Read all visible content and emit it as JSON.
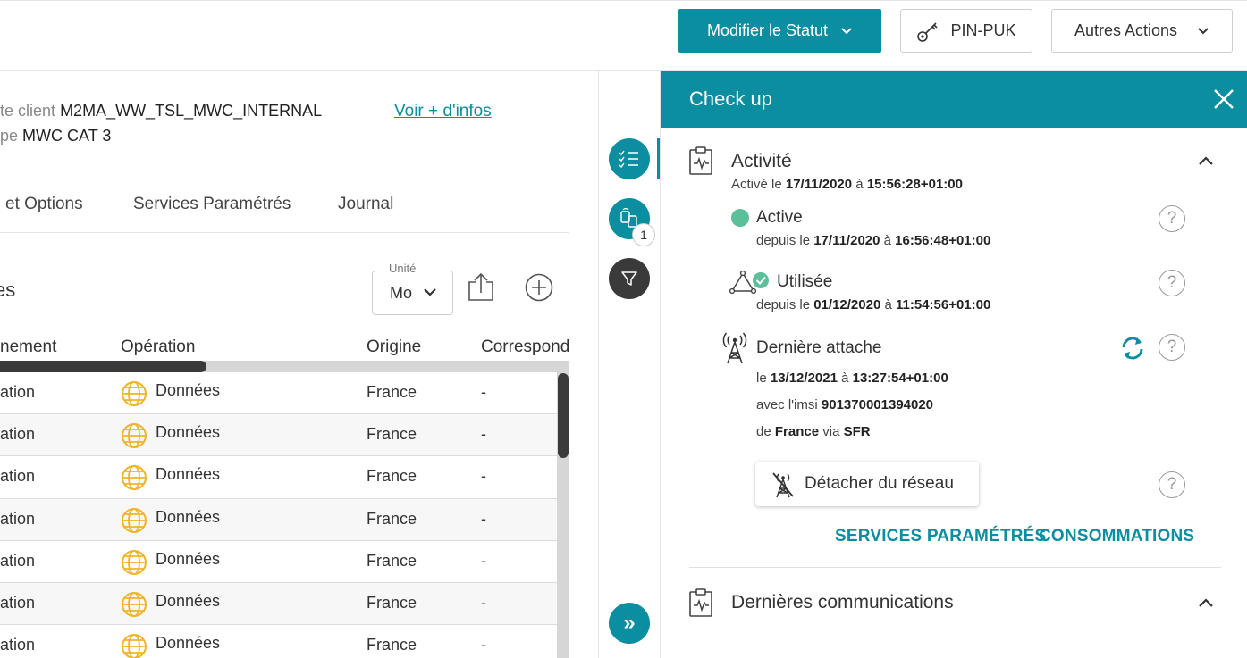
{
  "toolbar": {
    "modify_status_label": "Modifier le Statut",
    "pin_puk_label": "PIN-PUK",
    "other_actions_label": "Autres Actions"
  },
  "details": {
    "client_label": "te client",
    "client_value": "M2MA_WW_TSL_MWC_INTERNAL",
    "type_label": "pe",
    "type_value": "MWC CAT 3",
    "more_info_link": "Voir + d'infos"
  },
  "tabs": [
    {
      "label": "et Options"
    },
    {
      "label": "Services Paramétrés"
    },
    {
      "label": "Journal"
    }
  ],
  "section": {
    "title": "es",
    "unit_label": "Unité",
    "unit_value": "Mo"
  },
  "table": {
    "headers": [
      "nement",
      "Opération",
      "Origine",
      "Correspond"
    ],
    "rows": [
      {
        "event": "ation",
        "operation": "Données",
        "origin": "France",
        "correspondent": "-"
      },
      {
        "event": "ation",
        "operation": "Données",
        "origin": "France",
        "correspondent": "-"
      },
      {
        "event": "ation",
        "operation": "Données",
        "origin": "France",
        "correspondent": "-"
      },
      {
        "event": "ation",
        "operation": "Données",
        "origin": "France",
        "correspondent": "-"
      },
      {
        "event": "ation",
        "operation": "Données",
        "origin": "France",
        "correspondent": "-"
      },
      {
        "event": "ation",
        "operation": "Données",
        "origin": "France",
        "correspondent": "-"
      },
      {
        "event": "ation",
        "operation": "Données",
        "origin": "France",
        "correspondent": "-"
      }
    ]
  },
  "strip": {
    "badge_count": "1",
    "expand_glyph": "»"
  },
  "checkup": {
    "title": "Check up",
    "activity": {
      "title": "Activité",
      "activated_prefix": "Activé le",
      "activated_date": "17/11/2020",
      "at": "à",
      "activated_time": "15:56:28+01:00"
    },
    "active": {
      "label": "Active",
      "since_prefix": "depuis le",
      "date": "17/11/2020",
      "at": "à",
      "time": "16:56:48+01:00"
    },
    "used": {
      "label": "Utilisée",
      "since_prefix": "depuis le",
      "date": "01/12/2020",
      "at": "à",
      "time": "11:54:56+01:00"
    },
    "last_attach": {
      "label": "Dernière attache",
      "date_prefix": "le",
      "date": "13/12/2021",
      "at": "à",
      "time": "13:27:54+01:00",
      "imsi_prefix": "avec l'imsi",
      "imsi": "901370001394020",
      "country_prefix": "de",
      "country": "France",
      "via": "via",
      "operator": "SFR"
    },
    "detach_button": "Détacher du réseau",
    "help_glyph": "?",
    "links": {
      "services": "SERVICES PARAMÉTRÉS",
      "consumption": "CONSOMMATIONS"
    },
    "last_comms_title": "Dernières communications"
  },
  "colors": {
    "accent": "#0a8ea0",
    "active_dot": "#5bbf9a",
    "globe": "#f0b429"
  }
}
